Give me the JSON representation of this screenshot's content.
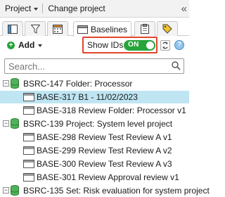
{
  "topbar": {
    "project_label": "Project",
    "change_project_label": "Change project",
    "collapse_icon": "double-chevron-left-icon"
  },
  "tabs": [
    {
      "name": "tab-hierarchy",
      "icon": "hierarchy-icon",
      "label": ""
    },
    {
      "name": "tab-filter",
      "icon": "filter-icon",
      "label": ""
    },
    {
      "name": "tab-calendar",
      "icon": "calendar-icon",
      "label": ""
    },
    {
      "name": "tab-baselines",
      "icon": "baseline-icon",
      "label": "Baselines",
      "active": true
    },
    {
      "name": "tab-clipboard",
      "icon": "clipboard-icon",
      "label": ""
    },
    {
      "name": "tab-tag",
      "icon": "tag-icon",
      "label": ""
    }
  ],
  "toolbar": {
    "add_label": "Add",
    "show_ids_label": "Show IDs",
    "toggle_state": "ON",
    "toggle_on": true,
    "highlight_color": "#e2452c",
    "toggle_color": "#27a43a"
  },
  "search": {
    "placeholder": "Search...",
    "value": ""
  },
  "tree": {
    "selected_color": "#bfe5f2",
    "nodes": [
      {
        "type": "folder",
        "expanded": true,
        "label": "BSRC-147 Folder: Processor"
      },
      {
        "type": "baseline",
        "label": "BASE-317 B1 - 11/02/2023",
        "selected": true
      },
      {
        "type": "baseline",
        "label": "BASE-318 Review Folder: Processor v1"
      },
      {
        "type": "folder",
        "expanded": true,
        "label": "BSRC-139 Project: System level project"
      },
      {
        "type": "baseline",
        "label": "BASE-298 Review Test Review A v1"
      },
      {
        "type": "baseline",
        "label": "BASE-299 Review Test Review A v2"
      },
      {
        "type": "baseline",
        "label": "BASE-300 Review Test Review A v3"
      },
      {
        "type": "baseline",
        "label": "BASE-301 Review Approval review v1"
      },
      {
        "type": "folder",
        "expanded": true,
        "label": "BSRC-135 Set: Risk evaluation for system project"
      }
    ]
  }
}
